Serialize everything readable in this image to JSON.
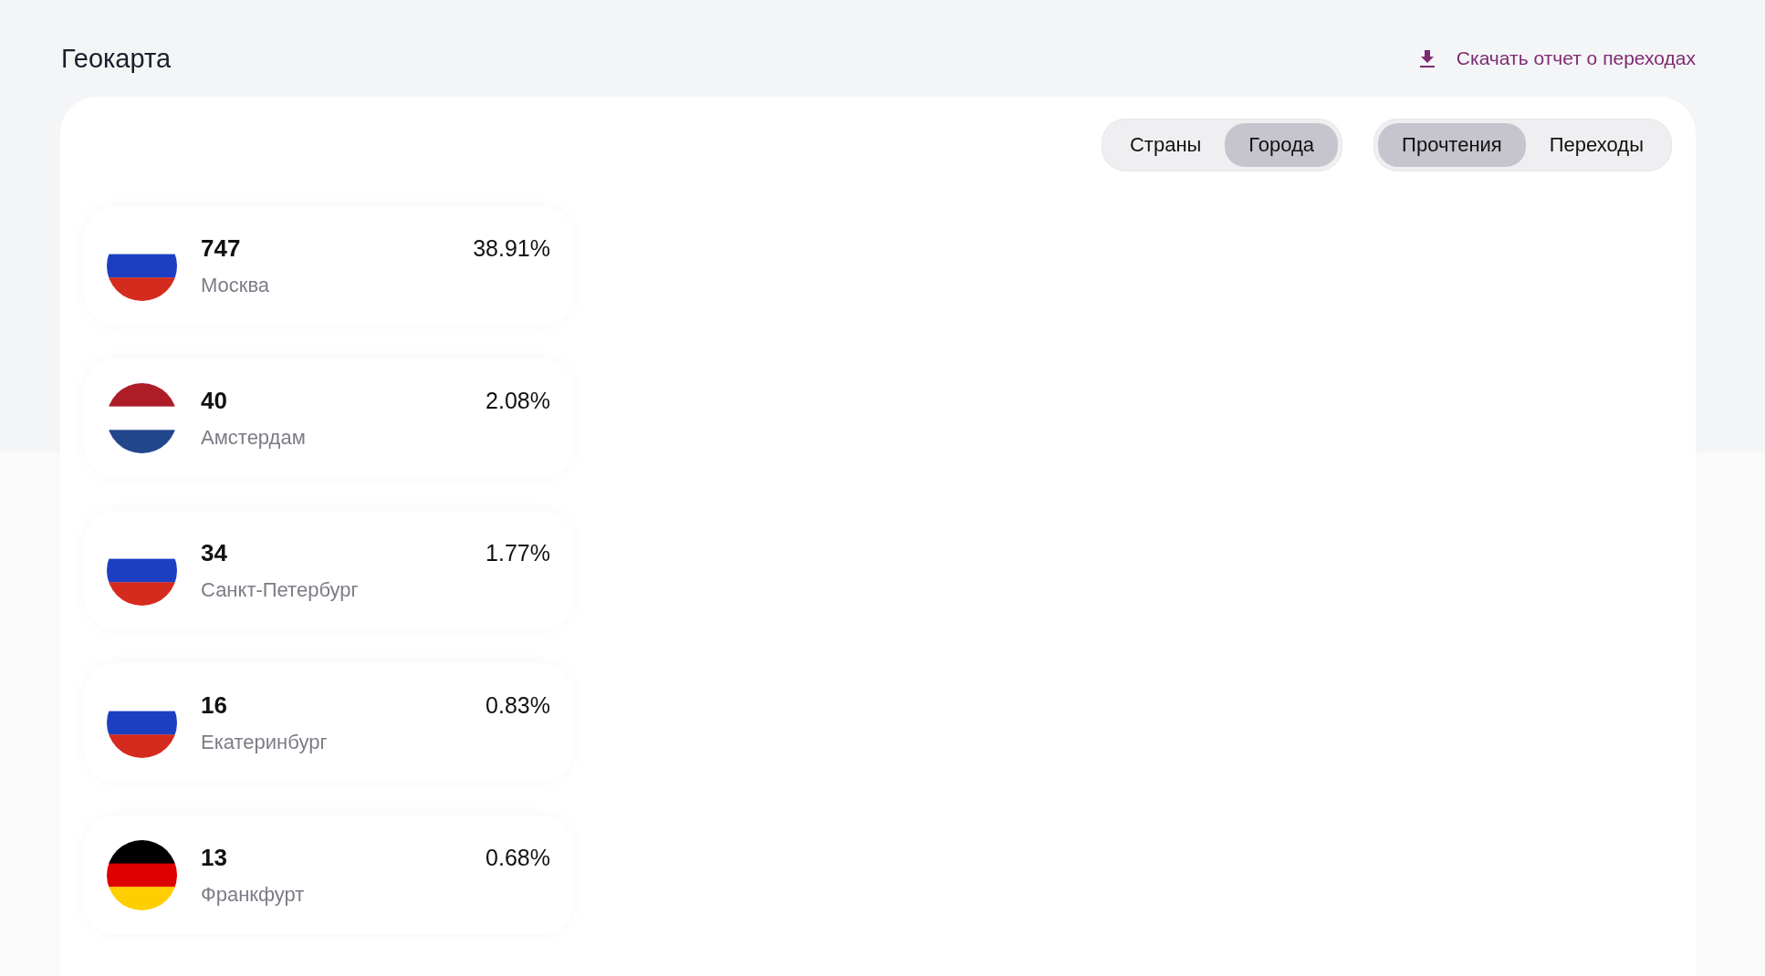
{
  "title": "Геокарта",
  "download_link": "Скачать отчет о переходах",
  "region_tabs": [
    {
      "label": "Страны",
      "selected": false
    },
    {
      "label": "Города",
      "selected": true
    }
  ],
  "metric_tabs": [
    {
      "label": "Прочтения",
      "selected": true
    },
    {
      "label": "Переходы",
      "selected": false
    }
  ],
  "cities": [
    {
      "kind": "ru",
      "count": "747",
      "share": "38.91%",
      "city": "Москва"
    },
    {
      "kind": "nl",
      "count": "40",
      "share": "2.08%",
      "city": "Амстердам"
    },
    {
      "kind": "ru",
      "count": "34",
      "share": "1.77%",
      "city": "Санкт-Петербург"
    },
    {
      "kind": "ru",
      "count": "16",
      "share": "0.83%",
      "city": "Екатеринбург"
    },
    {
      "kind": "de",
      "count": "13",
      "share": "0.68%",
      "city": "Франкфурт"
    }
  ]
}
